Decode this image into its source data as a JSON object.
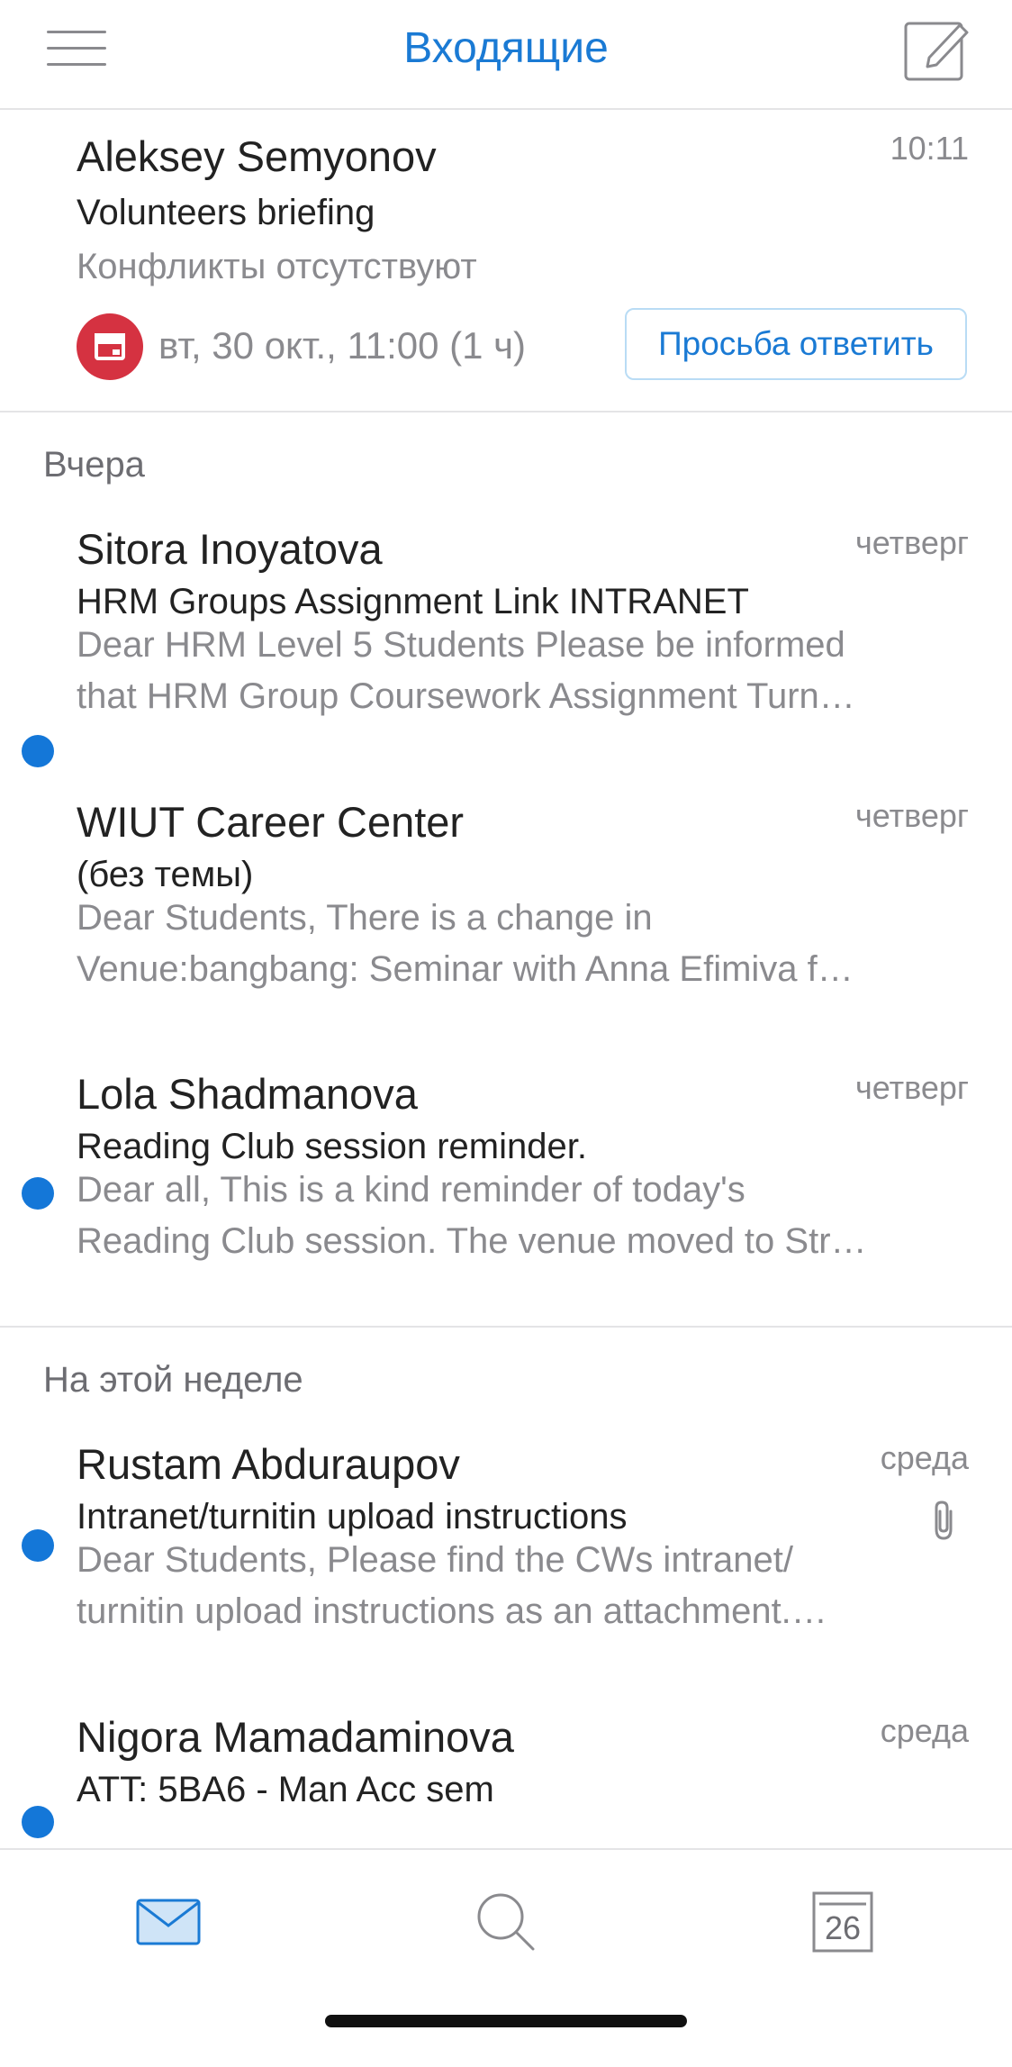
{
  "header": {
    "title": "Входящие",
    "menu_icon": "hamburger-menu-icon",
    "compose_icon": "compose-icon"
  },
  "pinned": {
    "sender": "Aleksey Semyonov",
    "time": "10:11",
    "subject": "Volunteers briefing",
    "status": "Конфликты отсутствуют",
    "event_time": "вт, 30 окт., 11:00 (1 ч)",
    "rsvp_label": "Просьба ответить",
    "badge_color": "#d53241"
  },
  "sections": [
    {
      "title": "Вчера",
      "messages": [
        {
          "sender": "Sitora Inoyatova",
          "date": "четверг",
          "unread": true,
          "subject": "HRM Groups Assignment Link INTRANET",
          "preview": [
            "Dear HRM Level 5 Students Please be informed",
            "that HRM Group Coursework Assignment Turn…"
          ]
        },
        {
          "sender": "WIUT Career Center",
          "date": "четверг",
          "unread": false,
          "subject": "(без темы)",
          "preview": [
            "Dear Students, There is a change in",
            "Venue:bangbang: Seminar with Anna Efimiva f…"
          ]
        },
        {
          "sender": "Lola Shadmanova",
          "date": "четверг",
          "unread": true,
          "subject": "Reading Club session reminder.",
          "preview": [
            "Dear all, This is a kind reminder of today's",
            "Reading Club session. The venue moved to Str…"
          ]
        }
      ]
    },
    {
      "title": "На этой неделе",
      "messages": [
        {
          "sender": "Rustam Abduraupov",
          "date": "среда",
          "unread": true,
          "attachment": true,
          "subject": "Intranet/turnitin upload instructions",
          "preview": [
            "Dear Students, Please find the CWs intranet/",
            "turnitin upload instructions as an attachment.…"
          ]
        },
        {
          "sender": "Nigora Mamadaminova",
          "date": "среда",
          "unread": true,
          "subject": "ATT: 5BA6 - Man Acc sem",
          "preview": []
        }
      ]
    }
  ],
  "tabbar": {
    "mail_icon": "mail-icon",
    "search_icon": "search-icon",
    "calendar_icon": "calendar-icon",
    "calendar_day": "26"
  },
  "colors": {
    "accent": "#1a7ad4",
    "unread_dot": "#1477d8"
  }
}
